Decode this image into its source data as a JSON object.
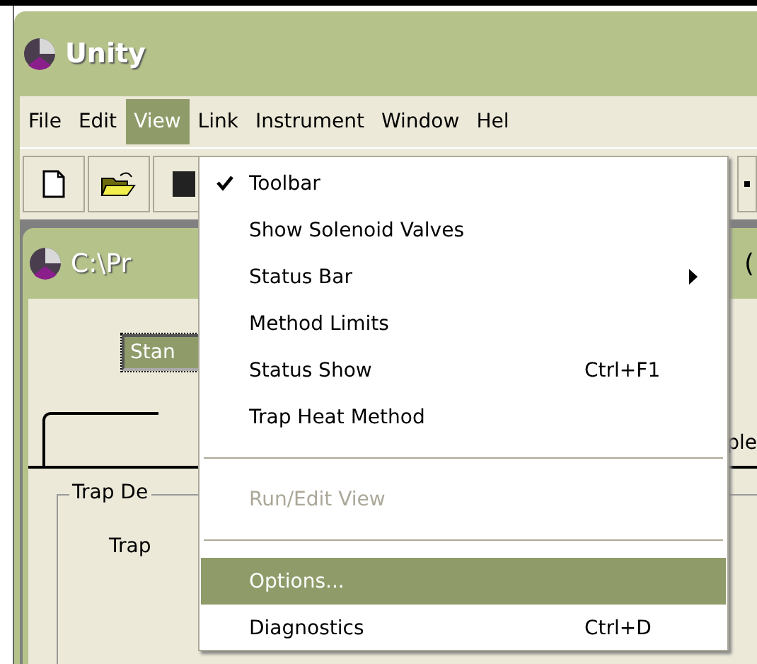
{
  "window": {
    "title": "Unity"
  },
  "menubar": [
    {
      "label": "File",
      "selected": false
    },
    {
      "label": "Edit",
      "selected": false
    },
    {
      "label": "View",
      "selected": true
    },
    {
      "label": "Link",
      "selected": false
    },
    {
      "label": "Instrument",
      "selected": false
    },
    {
      "label": "Window",
      "selected": false
    },
    {
      "label": "Hel",
      "selected": false
    }
  ],
  "view_menu": [
    {
      "kind": "item",
      "label": "Toolbar",
      "checked": true,
      "selected": false,
      "disabled": false,
      "submenu": false
    },
    {
      "kind": "item",
      "label": "Show Solenoid Valves",
      "checked": false,
      "selected": false,
      "disabled": false,
      "submenu": false
    },
    {
      "kind": "item",
      "label": "Status Bar",
      "checked": false,
      "selected": false,
      "disabled": false,
      "submenu": true
    },
    {
      "kind": "item",
      "label": "Method Limits",
      "checked": false,
      "selected": false,
      "disabled": false,
      "submenu": false
    },
    {
      "kind": "item",
      "label": "Status Show",
      "shortcut": "Ctrl+F1",
      "checked": false,
      "selected": false,
      "disabled": false,
      "submenu": false
    },
    {
      "kind": "item",
      "label": "Trap Heat Method",
      "checked": false,
      "selected": false,
      "disabled": false,
      "submenu": false
    },
    {
      "kind": "separator"
    },
    {
      "kind": "item",
      "label": "Run/Edit View",
      "checked": false,
      "selected": false,
      "disabled": true,
      "submenu": false
    },
    {
      "kind": "separator"
    },
    {
      "kind": "item",
      "label": "Options...",
      "checked": false,
      "selected": true,
      "disabled": false,
      "submenu": false
    },
    {
      "kind": "item",
      "label": "Diagnostics",
      "shortcut": "Ctrl+D",
      "checked": false,
      "selected": false,
      "disabled": false,
      "submenu": false
    }
  ],
  "child_window": {
    "title": "C:\\Pr",
    "title_tail": "(",
    "dropdown_value": "Stan",
    "tab_label": "ple",
    "group_label": "Trap De",
    "field_label": "Trap"
  }
}
